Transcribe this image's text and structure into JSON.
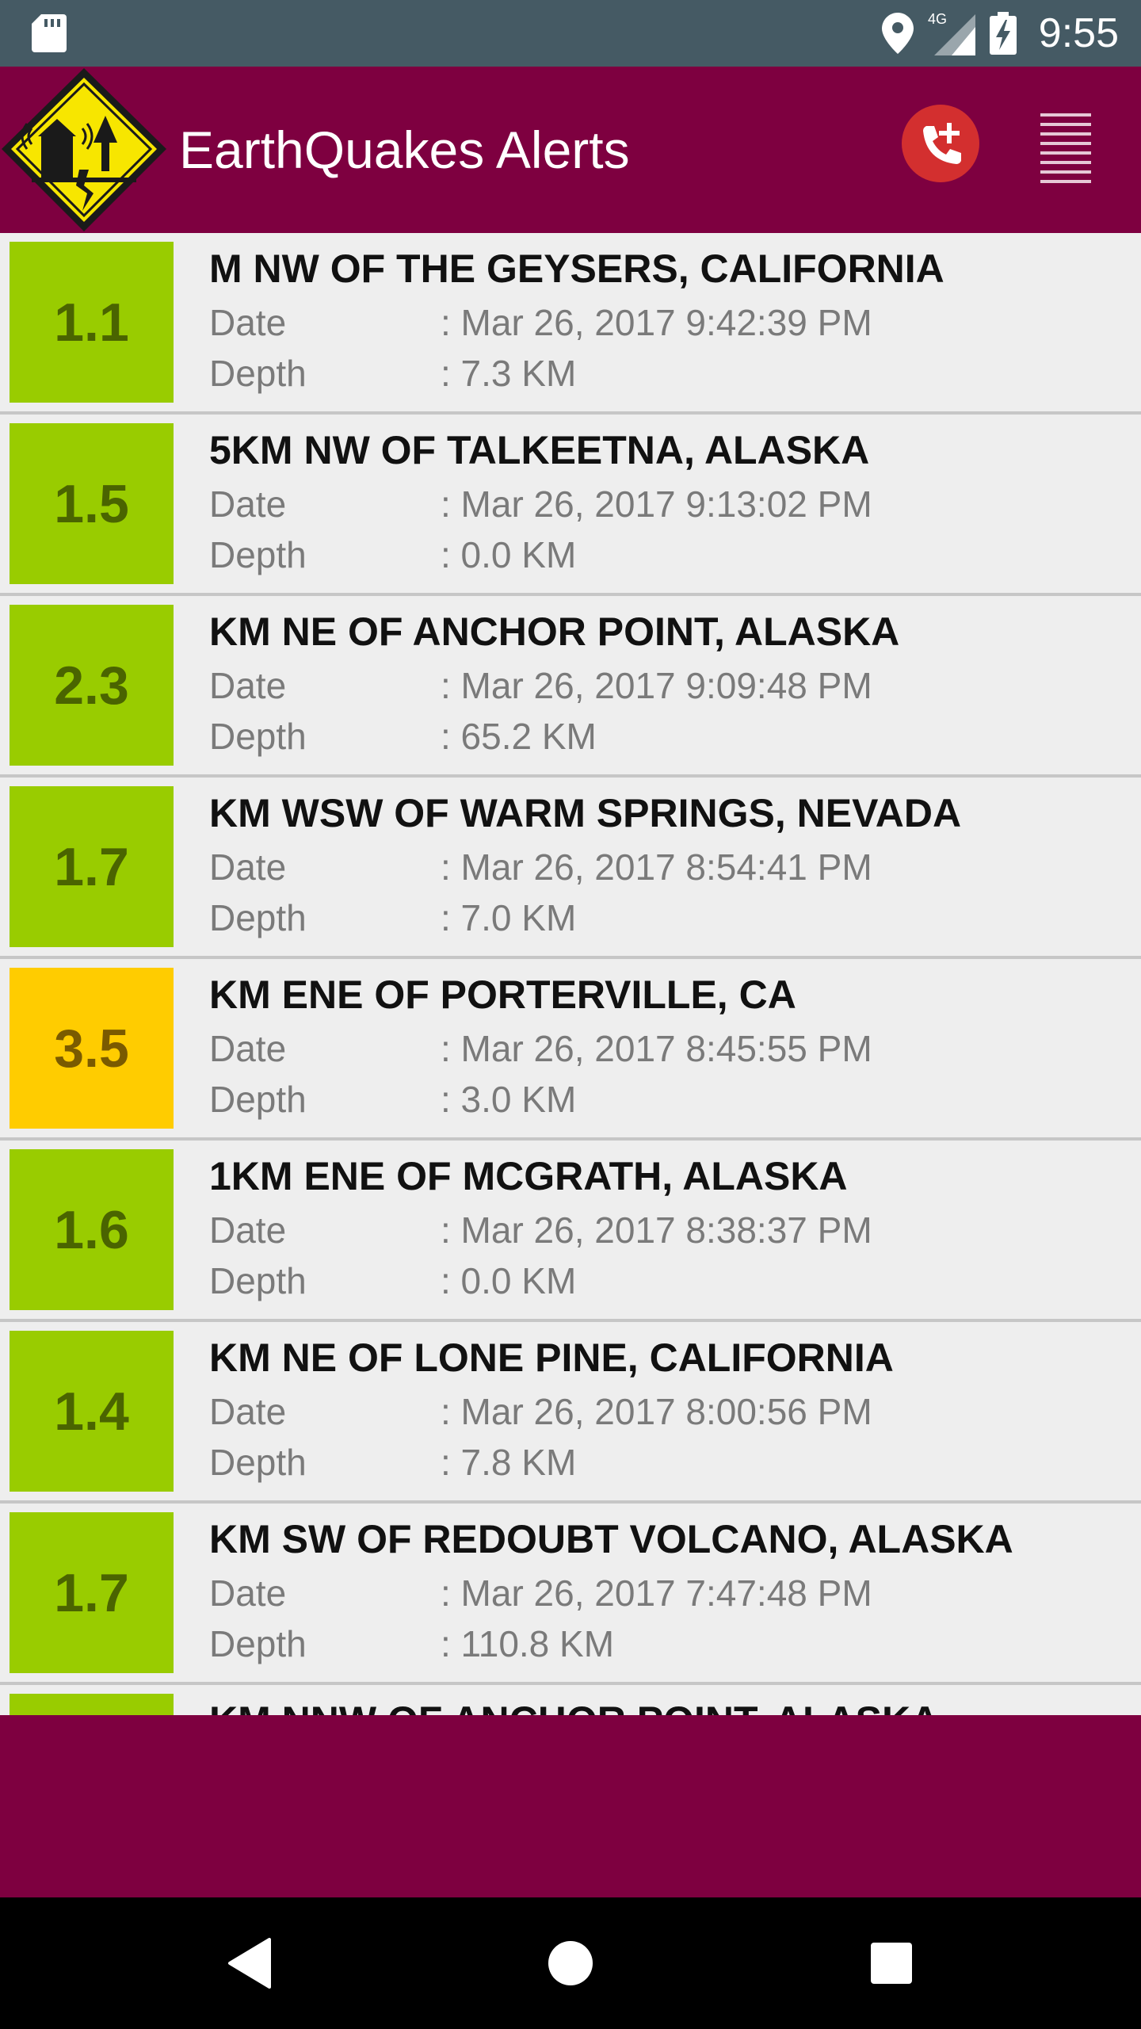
{
  "status_bar": {
    "time": "9:55",
    "network": "4G"
  },
  "app_bar": {
    "title": "EarthQuakes Alerts"
  },
  "colors": {
    "app_bar": "#7e0040",
    "status_bar": "#455a64",
    "mag_low": "#99cc00",
    "mag_low_text": "#4a6400",
    "mag_mid": "#ffcc00",
    "mag_mid_text": "#7a5a00"
  },
  "labels": {
    "date": "Date",
    "depth": "Depth"
  },
  "quakes": [
    {
      "magnitude": "1.1",
      "title": "M NW OF THE GEYSERS, CALIFORNIA",
      "date": ": Mar 26, 2017 9:42:39 PM",
      "depth": ": 7.3 KM",
      "level": "low"
    },
    {
      "magnitude": "1.5",
      "title": "5KM NW OF TALKEETNA, ALASKA",
      "date": ": Mar 26, 2017 9:13:02 PM",
      "depth": ": 0.0 KM",
      "level": "low"
    },
    {
      "magnitude": "2.3",
      "title": "KM NE OF ANCHOR POINT, ALASKA",
      "date": ": Mar 26, 2017 9:09:48 PM",
      "depth": ": 65.2 KM",
      "level": "low"
    },
    {
      "magnitude": "1.7",
      "title": "KM WSW OF WARM SPRINGS, NEVADA",
      "date": ": Mar 26, 2017 8:54:41 PM",
      "depth": ": 7.0 KM",
      "level": "low"
    },
    {
      "magnitude": "3.5",
      "title": "KM ENE OF PORTERVILLE, CA",
      "date": ": Mar 26, 2017 8:45:55 PM",
      "depth": ": 3.0 KM",
      "level": "mid"
    },
    {
      "magnitude": "1.6",
      "title": "1KM ENE OF MCGRATH, ALASKA",
      "date": ": Mar 26, 2017 8:38:37 PM",
      "depth": ": 0.0 KM",
      "level": "low"
    },
    {
      "magnitude": "1.4",
      "title": "KM NE OF LONE PINE, CALIFORNIA",
      "date": ": Mar 26, 2017 8:00:56 PM",
      "depth": ": 7.8 KM",
      "level": "low"
    },
    {
      "magnitude": "1.7",
      "title": "KM SW OF REDOUBT VOLCANO, ALASKA",
      "date": ": Mar 26, 2017 7:47:48 PM",
      "depth": ": 110.8 KM",
      "level": "low"
    },
    {
      "magnitude": "",
      "title": "KM NNW OF ANCHOR POINT, ALASKA",
      "date": "",
      "depth": "",
      "level": "low"
    }
  ]
}
